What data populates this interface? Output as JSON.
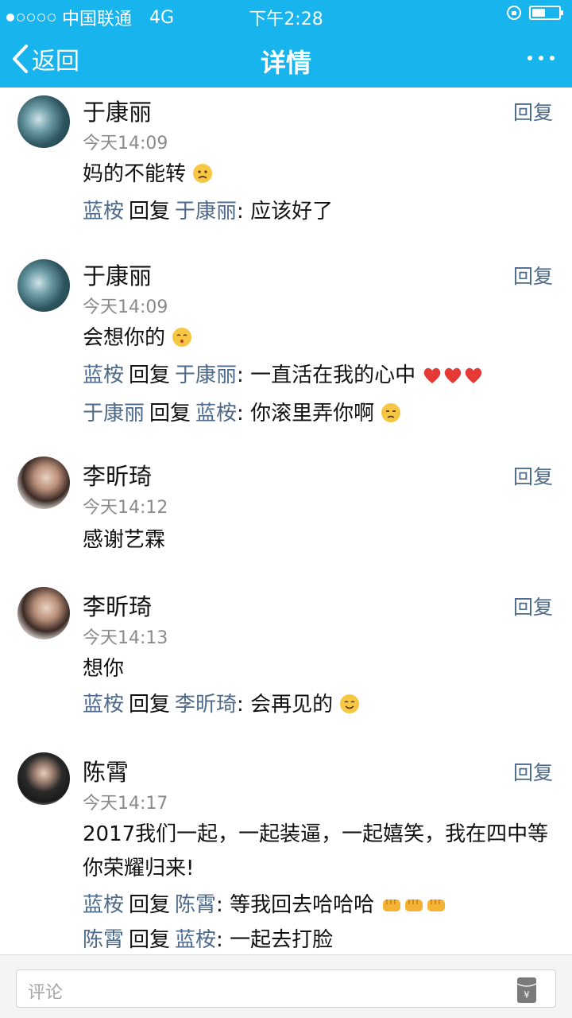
{
  "status": {
    "carrier": "中国联通",
    "network": "4G",
    "time": "下午2:28"
  },
  "nav": {
    "back_label": "返回",
    "title": "详情"
  },
  "comments": [
    {
      "name": "于康丽",
      "time": "今天14:09",
      "text": "妈的不能转",
      "text_emoji": "frowning-face",
      "reply_label": "回复",
      "replies": [
        {
          "from": "蓝桉",
          "verb": "回复",
          "to": "于康丽",
          "text": ": 应该好了"
        }
      ]
    },
    {
      "name": "于康丽",
      "time": "今天14:09",
      "text": "会想你的",
      "text_emoji": "kissing-face",
      "reply_label": "回复",
      "replies": [
        {
          "from": "蓝桉",
          "verb": "回复",
          "to": "于康丽",
          "text": ": 一直活在我的心中",
          "emoji": "heart x3"
        },
        {
          "from": "于康丽",
          "verb": "回复",
          "to": "蓝桉",
          "text": ": 你滚里弄你啊",
          "emoji": "unamused-face"
        }
      ]
    },
    {
      "name": "李昕琦",
      "time": "今天14:12",
      "text": "感谢艺霖",
      "reply_label": "回复",
      "replies": []
    },
    {
      "name": "李昕琦",
      "time": "今天14:13",
      "text": "想你",
      "reply_label": "回复",
      "replies": [
        {
          "from": "蓝桉",
          "verb": "回复",
          "to": "李昕琦",
          "text": ": 会再见的",
          "emoji": "smiling-face"
        }
      ]
    },
    {
      "name": "陈霄",
      "time": "今天14:17",
      "text": "2017我们一起，一起装逼，一起嬉笑，我在四中等你荣耀归来!",
      "reply_label": "回复",
      "replies": [
        {
          "from": "蓝桉",
          "verb": "回复",
          "to": "陈霄",
          "text": ": 等我回去哈哈哈",
          "emoji": "fist x3"
        },
        {
          "from": "陈霄",
          "verb": "回复",
          "to": "蓝桉",
          "text": ": 一起去打脸"
        }
      ]
    }
  ],
  "composer": {
    "placeholder": "评论"
  },
  "colors": {
    "header": "#18b4ed",
    "username": "#4e6a8a",
    "timestamp": "#8a8a8a"
  }
}
